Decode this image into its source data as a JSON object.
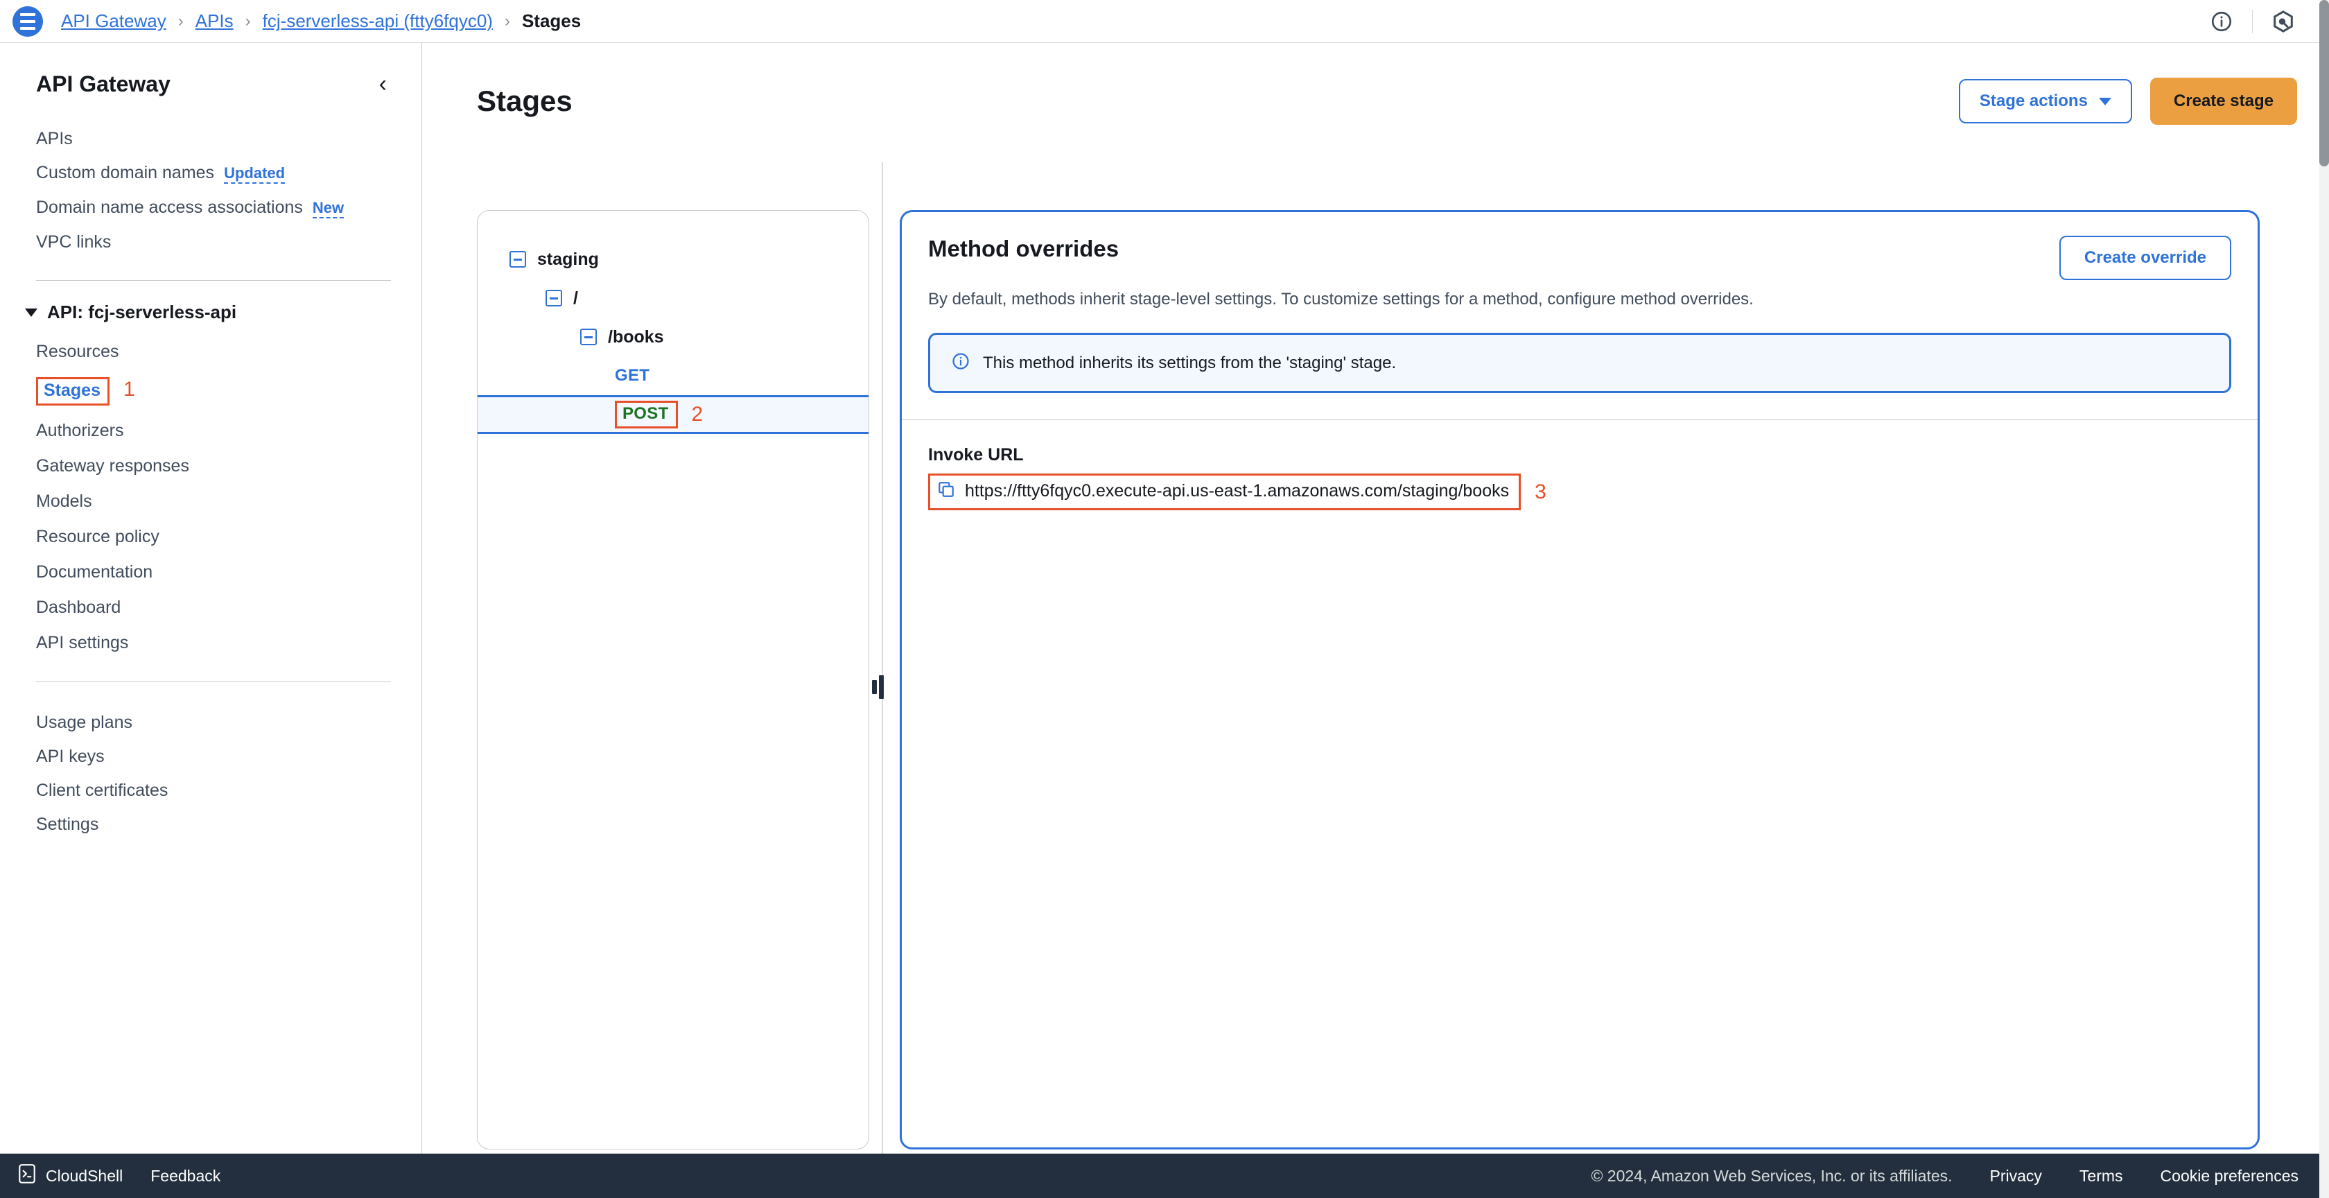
{
  "topbar": {
    "menu_icon": "hamburger-menu-icon",
    "breadcrumb": [
      {
        "label": "API Gateway",
        "current": false
      },
      {
        "label": "APIs",
        "current": false
      },
      {
        "label": "fcj-serverless-api (ftty6fqyc0)",
        "current": false
      },
      {
        "label": "Stages",
        "current": true
      }
    ],
    "separator": "›",
    "info_icon": "info-circle-icon",
    "settings_icon": "hexagon-settings-icon"
  },
  "sidebar": {
    "title": "API Gateway",
    "collapse_icon": "chevron-left-icon",
    "top_items": [
      {
        "label": "APIs",
        "badge": ""
      },
      {
        "label": "Custom domain names",
        "badge": "Updated"
      },
      {
        "label": "Domain name access associations",
        "badge": "New"
      },
      {
        "label": "VPC links",
        "badge": ""
      }
    ],
    "group": {
      "label": "API: fcj-serverless-api",
      "caret_icon": "caret-down-icon",
      "items": [
        {
          "label": "Resources",
          "selected": false
        },
        {
          "label": "Stages",
          "selected": true,
          "step": "1"
        },
        {
          "label": "Authorizers",
          "selected": false
        },
        {
          "label": "Gateway responses",
          "selected": false
        },
        {
          "label": "Models",
          "selected": false
        },
        {
          "label": "Resource policy",
          "selected": false
        },
        {
          "label": "Documentation",
          "selected": false
        },
        {
          "label": "Dashboard",
          "selected": false
        },
        {
          "label": "API settings",
          "selected": false
        }
      ]
    },
    "bottom_items": [
      {
        "label": "Usage plans"
      },
      {
        "label": "API keys"
      },
      {
        "label": "Client certificates"
      },
      {
        "label": "Settings"
      }
    ]
  },
  "main": {
    "page_title": "Stages",
    "stage_actions_label": "Stage actions",
    "stage_actions_caret": "caret-down-icon",
    "create_stage_label": "Create stage"
  },
  "tree": {
    "nodes": [
      {
        "type": "stage",
        "label": "staging",
        "indent": 0,
        "expandable": true,
        "selected": false
      },
      {
        "type": "resource",
        "label": "/",
        "indent": 1,
        "expandable": true,
        "selected": false
      },
      {
        "type": "resource",
        "label": "/books",
        "indent": 2,
        "expandable": true,
        "selected": false
      },
      {
        "type": "method",
        "label": "GET",
        "indent": 3,
        "expandable": false,
        "selected": false,
        "method_color": "get"
      },
      {
        "type": "method",
        "label": "POST",
        "indent": 3,
        "expandable": false,
        "selected": true,
        "method_color": "post",
        "step": "2"
      }
    ]
  },
  "detail": {
    "title": "Method overrides",
    "create_override_label": "Create override",
    "description": "By default, methods inherit stage-level settings. To customize settings for a method, configure method overrides.",
    "alert": {
      "icon": "info-circle-icon",
      "text": "This method inherits its settings from the 'staging' stage."
    },
    "invoke": {
      "label": "Invoke URL",
      "copy_icon": "copy-icon",
      "url": "https://ftty6fqyc0.execute-api.us-east-1.amazonaws.com/staging/books",
      "step": "3"
    }
  },
  "footer": {
    "cloudshell_icon": "cloudshell-icon",
    "cloudshell_label": "CloudShell",
    "feedback_label": "Feedback",
    "copyright": "© 2024, Amazon Web Services, Inc. or its affiliates.",
    "links": [
      {
        "label": "Privacy"
      },
      {
        "label": "Terms"
      },
      {
        "label": "Cookie preferences"
      }
    ]
  },
  "colors": {
    "accent_blue": "#2f72d9",
    "annotation_orange": "#e8502a",
    "primary_orange": "#eb9f41",
    "post_green": "#1d7324",
    "dark_navy": "#232f3e"
  }
}
